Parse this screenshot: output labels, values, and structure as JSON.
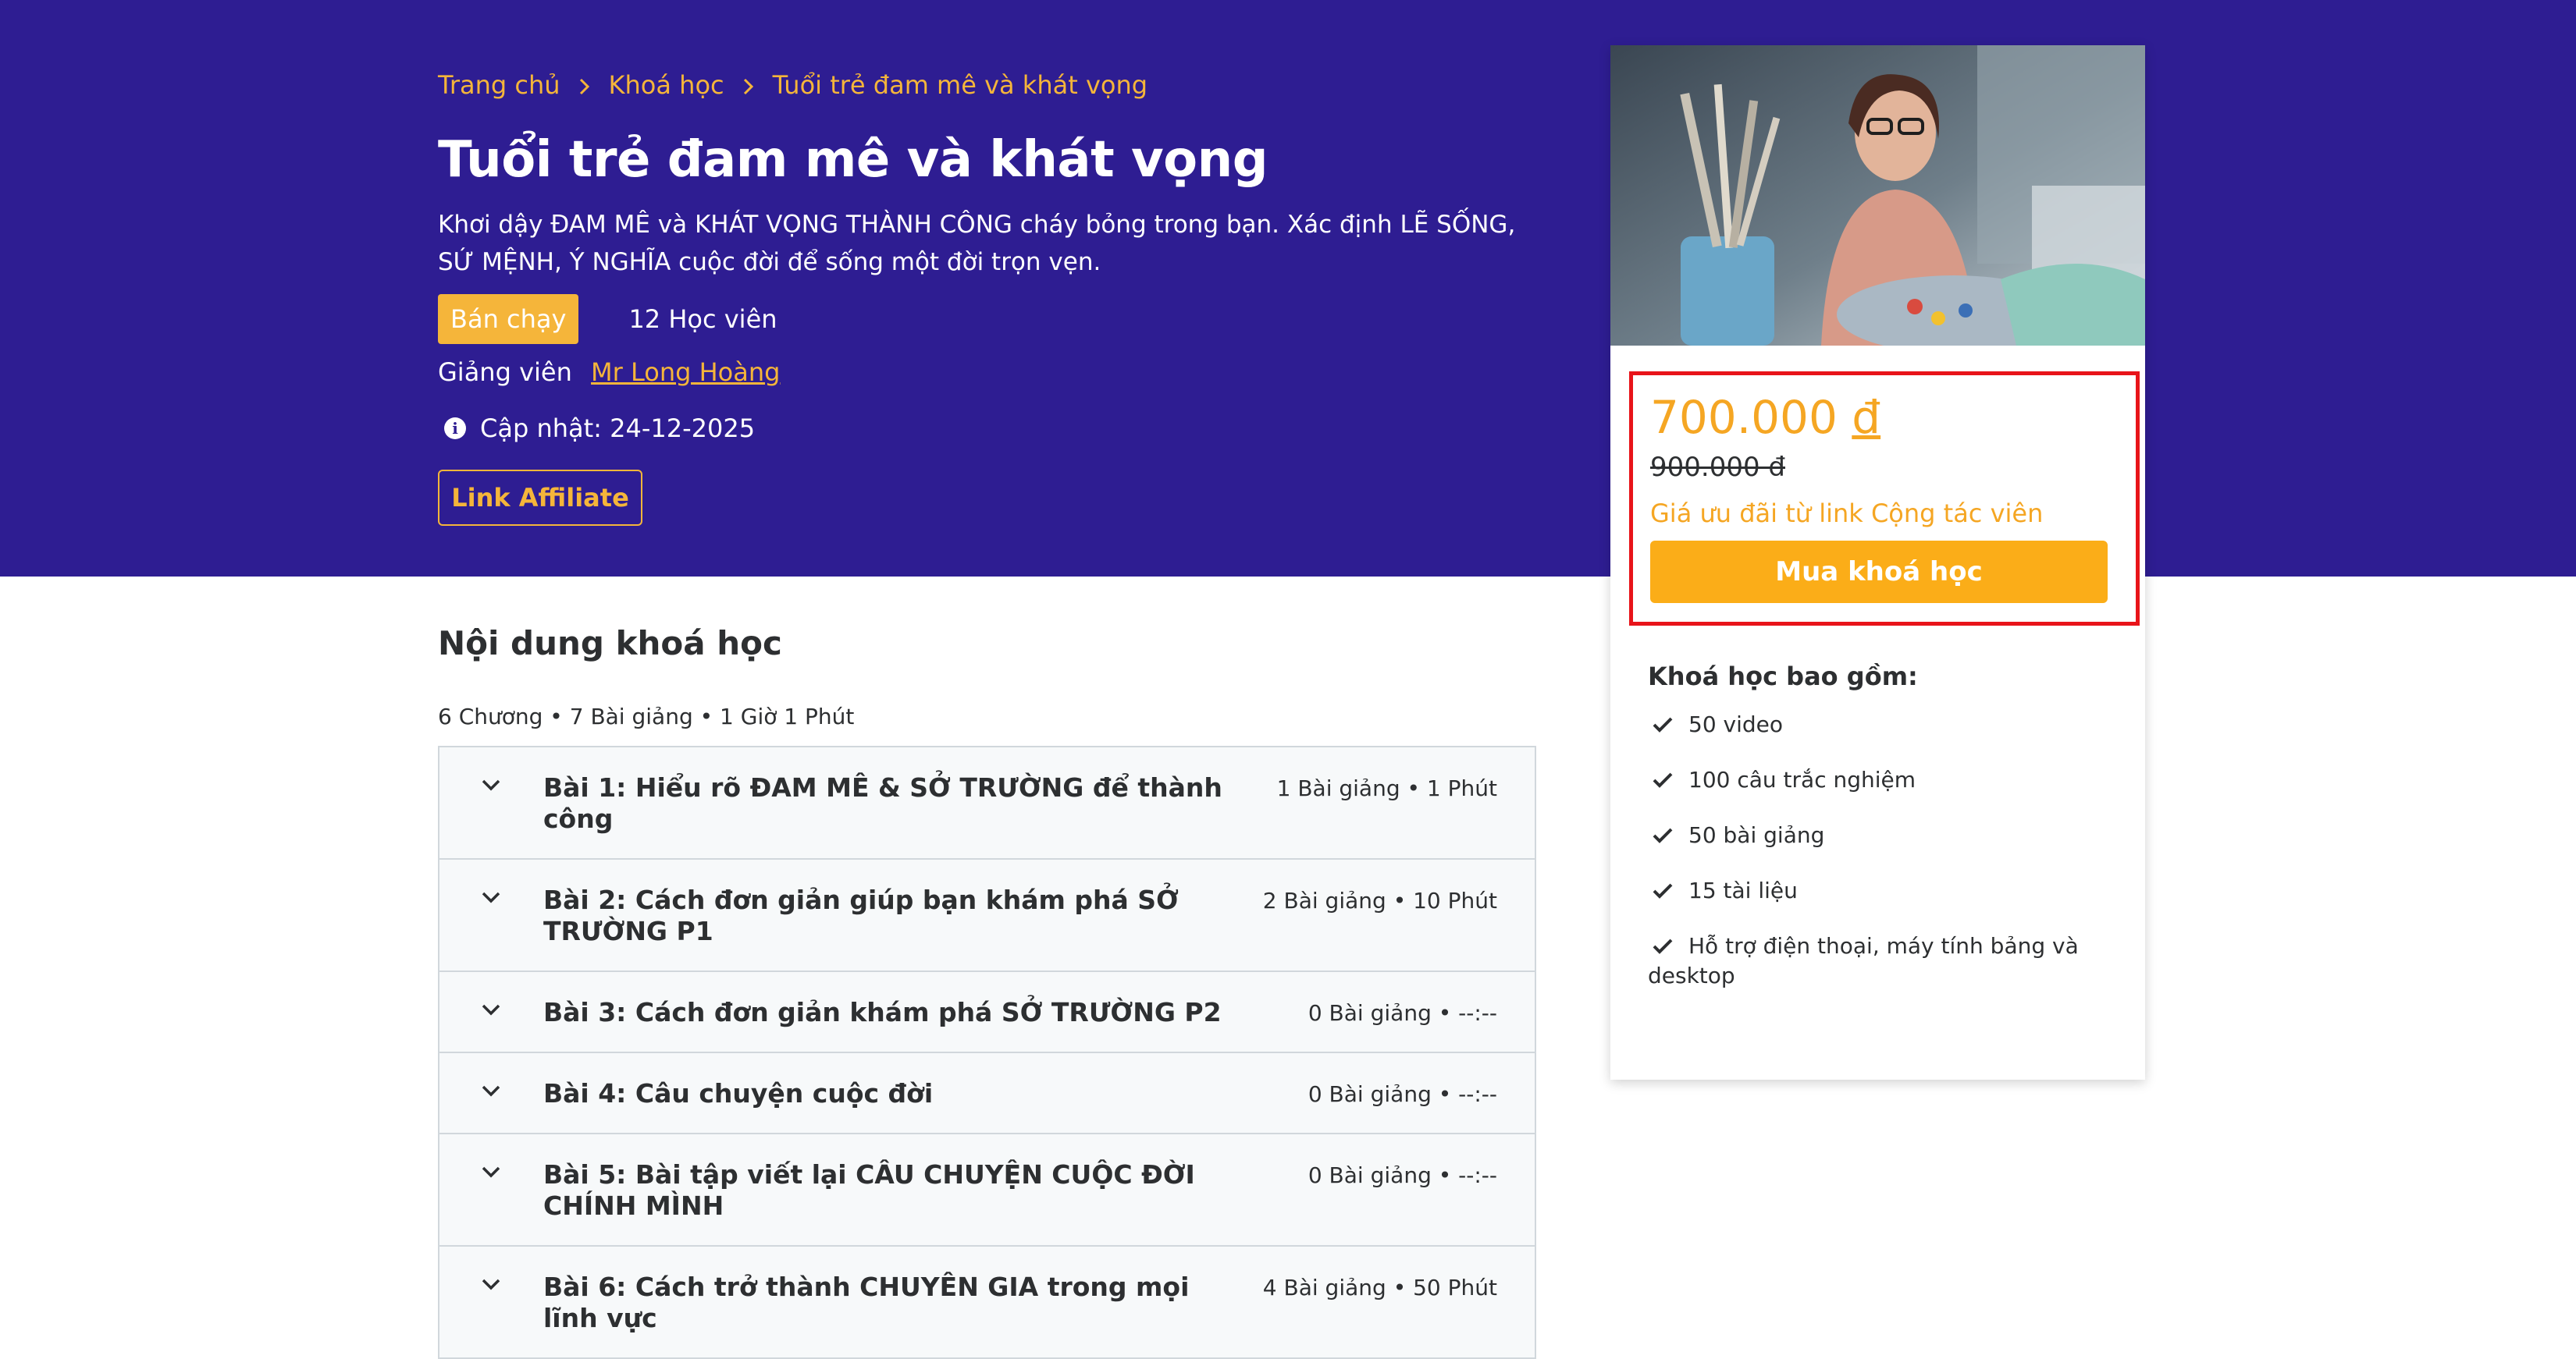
{
  "breadcrumb": {
    "items": [
      "Trang chủ",
      "Khoá học",
      "Tuổi trẻ đam mê và khát vọng"
    ]
  },
  "course": {
    "title": "Tuổi trẻ đam mê và khát vọng",
    "subtitle": "Khơi dậy ĐAM MÊ và KHÁT VỌNG THÀNH CÔNG cháy bỏng trong bạn. Xác định LẼ SỐNG, SỨ MỆNH, Ý NGHĨA cuộc đời để sống một đời trọn vẹn.",
    "badge": "Bán chạy",
    "students": "12 Học viên",
    "instructor_label": "Giảng viên",
    "instructor_name": "Mr Long Hoàng",
    "updated": "Cập nhật: 24-12-2025",
    "affiliate_button": "Link Affiliate"
  },
  "content": {
    "heading": "Nội dung khoá học",
    "summary": "6 Chương • 7 Bài giảng • 1 Giờ 1 Phút",
    "chapters": [
      {
        "title": "Bài 1: Hiểu rõ ĐAM MÊ & SỞ TRƯỜNG để thành công",
        "meta": "1 Bài giảng • 1 Phút"
      },
      {
        "title": "Bài 2: Cách đơn giản giúp bạn khám phá SỞ TRƯỜNG P1",
        "meta": "2 Bài giảng • 10 Phút"
      },
      {
        "title": "Bài 3: Cách đơn giản khám phá SỞ TRƯỜNG P2",
        "meta": "0 Bài giảng • --:--"
      },
      {
        "title": "Bài 4: Câu chuyện cuộc đời",
        "meta": "0 Bài giảng • --:--"
      },
      {
        "title": "Bài 5: Bài tập viết lại CÂU CHUYỆN CUỘC ĐỜI CHÍNH MÌNH",
        "meta": "0 Bài giảng • --:--"
      },
      {
        "title": "Bài 6: Cách trở thành CHUYÊN GIA trong mọi lĩnh vực",
        "meta": "4 Bài giảng • 50 Phút"
      }
    ]
  },
  "sidebar": {
    "price": "700.000",
    "currency": "đ",
    "old_price": "900.000 đ",
    "affiliate_note": "Giá ưu đãi từ link Cộng tác viên",
    "buy_button": "Mua khoá học",
    "includes_title": "Khoá học bao gồm:",
    "includes": [
      "50 video",
      "100 câu trắc nghiệm",
      "50 bài giảng",
      "15 tài liệu",
      "Hỗ trợ điện thoại, máy tính bảng và desktop"
    ]
  },
  "colors": {
    "hero_bg": "#2e1d92",
    "accent": "#f5b53a",
    "buy_button": "#fbad18",
    "highlight_box": "#e8141a"
  },
  "icons": {
    "breadcrumb_separator": "chevron-right-icon",
    "updated": "info-icon",
    "chapter_toggle": "chevron-down-icon",
    "include_item": "check-icon"
  }
}
